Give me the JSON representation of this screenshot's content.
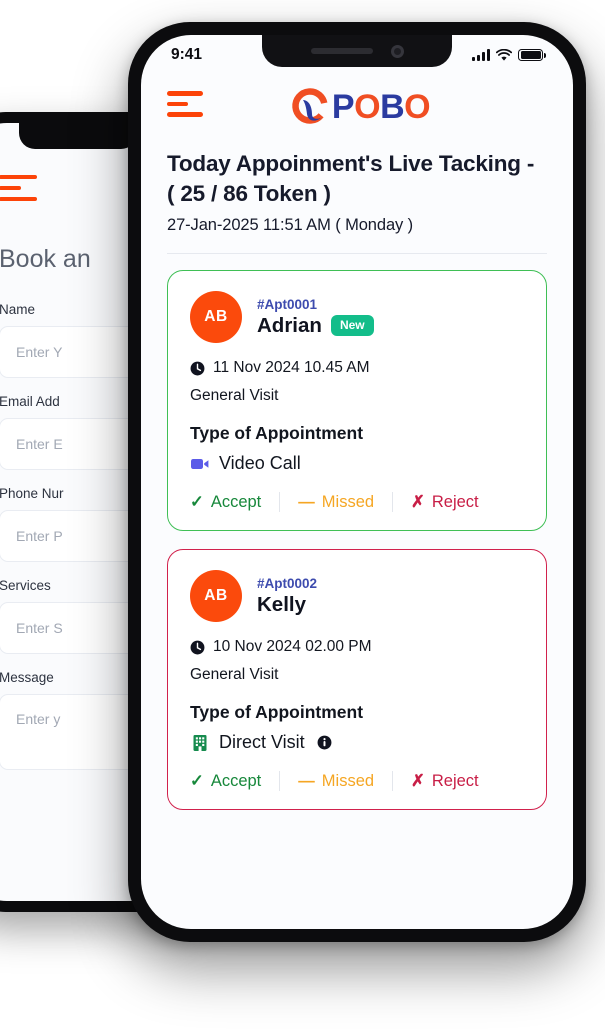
{
  "back_phone": {
    "menu_icon": "hamburger-icon",
    "title": "Book an",
    "fields": [
      {
        "label": "Name",
        "placeholder": "Enter Y"
      },
      {
        "label": "Email Add",
        "placeholder": "Enter E"
      },
      {
        "label": "Phone Nur",
        "placeholder": "Enter P"
      },
      {
        "label": "Services",
        "placeholder": "Enter S"
      },
      {
        "label": "Message",
        "placeholder": "Enter y"
      }
    ]
  },
  "front_phone": {
    "status_bar": {
      "time": "9:41",
      "signal_icon": "cellular-signal-icon",
      "wifi_icon": "wifi-icon",
      "battery_icon": "battery-full-icon"
    },
    "header": {
      "menu_icon": "hamburger-icon",
      "logo": {
        "q": "Q",
        "p": "P",
        "o1": "O",
        "b": "B",
        "o2": "O",
        "orange": "#F04E23",
        "blue": "#2B3BA0"
      }
    },
    "page_title": "Today Appoinment's Live Tacking - ( 25 / 86 Token )",
    "page_subtitle": "27-Jan-2025 11:51 AM ( Monday )",
    "cards": [
      {
        "border_color": "#3FBF55",
        "avatar_initials": "AB",
        "avatar_color": "#FB4A0C",
        "appointment_id": "#Apt0001",
        "patient_name": "Adrian",
        "badge": "New",
        "badge_color": "#13BD8A",
        "datetime": "11 Nov 2024 10.45 AM",
        "clock_icon": "clock-icon",
        "visit_type": "General Visit",
        "section_label": "Type of Appointment",
        "mode_icon": "video-camera-icon",
        "mode_label": "Video Call",
        "mode_color": "#5B5BE8",
        "has_info_icon": false,
        "actions": {
          "accept": "Accept",
          "missed": "Missed",
          "reject": "Reject",
          "accept_icon": "check-icon",
          "missed_icon": "dash-icon",
          "reject_icon": "cross-icon"
        }
      },
      {
        "border_color": "#D1214C",
        "avatar_initials": "AB",
        "avatar_color": "#FB4A0C",
        "appointment_id": "#Apt0002",
        "patient_name": "Kelly",
        "badge": "",
        "badge_color": "",
        "datetime": "10 Nov 2024 02.00 PM",
        "clock_icon": "clock-icon",
        "visit_type": "General Visit",
        "section_label": "Type of Appointment",
        "mode_icon": "building-icon",
        "mode_label": "Direct Visit",
        "mode_color": "#168B4E",
        "has_info_icon": true,
        "info_icon": "info-circle-icon",
        "actions": {
          "accept": "Accept",
          "missed": "Missed",
          "reject": "Reject",
          "accept_icon": "check-icon",
          "missed_icon": "dash-icon",
          "reject_icon": "cross-icon"
        }
      }
    ]
  }
}
